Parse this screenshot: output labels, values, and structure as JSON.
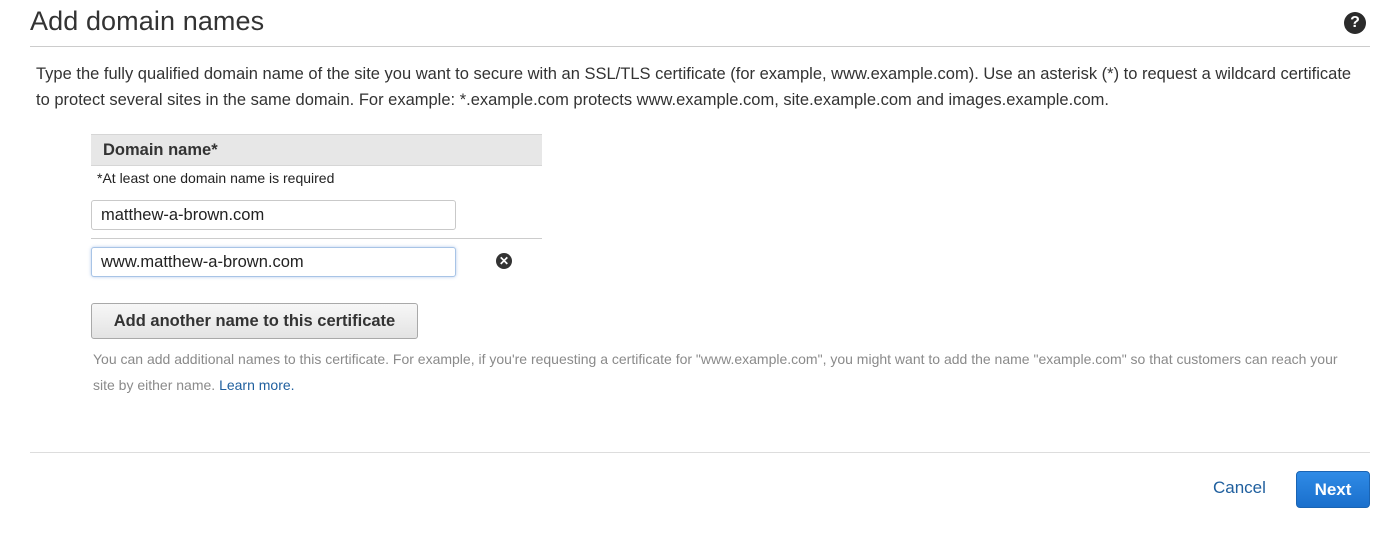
{
  "header": {
    "title": "Add domain names",
    "help_icon": "question-circle-icon",
    "help_glyph": "?"
  },
  "description": "Type the fully qualified domain name of the site you want to secure with an SSL/TLS certificate (for example, www.example.com). Use an asterisk (*) to request a wildcard certificate to protect several sites in the same domain. For example: *.example.com protects www.example.com, site.example.com and images.example.com.",
  "domain_table": {
    "header": "Domain name*",
    "required_note": "*At least one domain name is required",
    "domains": [
      {
        "value": "matthew-a-brown.com"
      },
      {
        "value": "www.matthew-a-brown.com"
      }
    ],
    "remove_icon": "remove-circle-icon",
    "remove_glyph": "✕"
  },
  "add_button_label": "Add another name to this certificate",
  "help_text": "You can add additional names to this certificate. For example, if you're requesting a certificate for \"www.example.com\", you might want to add the name \"example.com\" so that customers can reach your site by either name.",
  "learn_more": "Learn more.",
  "footer": {
    "cancel_label": "Cancel",
    "next_label": "Next"
  },
  "colors": {
    "primary_button": "#1a6fcc",
    "link": "#1f5f9e",
    "table_header_bg": "#e7e7e7"
  }
}
